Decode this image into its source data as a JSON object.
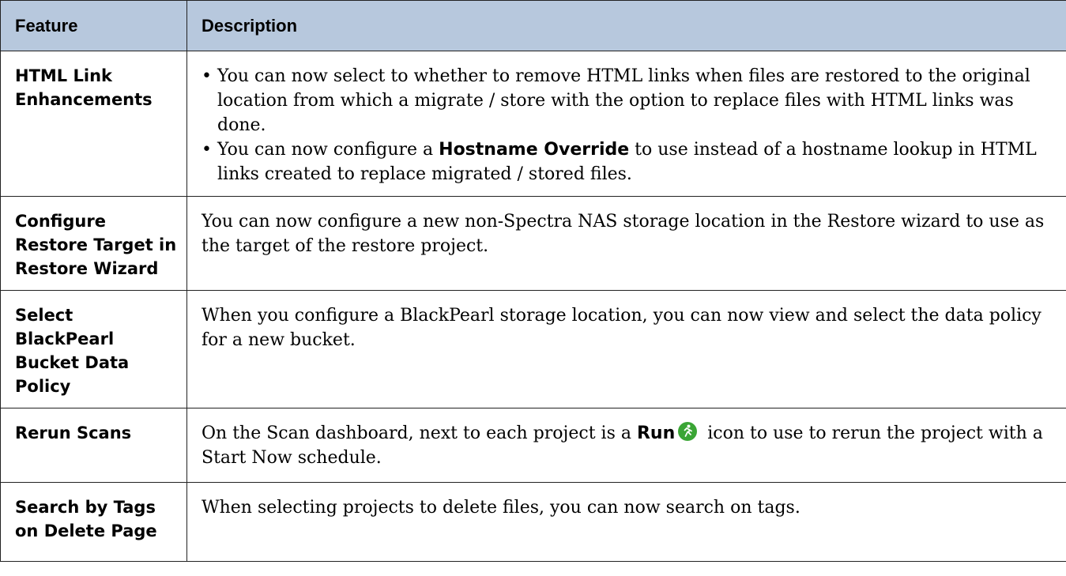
{
  "header": {
    "feature": "Feature",
    "description": "Description"
  },
  "rows": [
    {
      "feature": "HTML Link Enhancements",
      "bullets": [
        "You can now select to whether to remove HTML links when files are restored to the original location from which a migrate / store with the option to replace files with HTML links was done.",
        {
          "before": "You can now configure a ",
          "bold": "Hostname Override",
          "after": " to use instead of a hostname lookup in HTML links created to replace migrated / stored files."
        }
      ]
    },
    {
      "feature": "Configure Restore Target in Restore Wizard",
      "description": "You can now configure a new non-Spectra NAS storage location in the Restore wizard to use as the target of the restore project."
    },
    {
      "feature": "Select BlackPearl Bucket Data Policy",
      "description": "When you configure a BlackPearl storage location, you can now view and select the data policy for a new bucket."
    },
    {
      "feature": "Rerun Scans",
      "description_before": "On the Scan dashboard, next to each project is a ",
      "description_bold": "Run",
      "description_icon": "run-icon",
      "description_after": " icon to use to rerun the project with a Start Now schedule."
    },
    {
      "feature": "Search by Tags on Delete Page",
      "description": "When selecting projects to delete files, you can now search on tags."
    }
  ],
  "colors": {
    "header_bg": "#b7c8dd",
    "run_icon": "#3aa535"
  }
}
